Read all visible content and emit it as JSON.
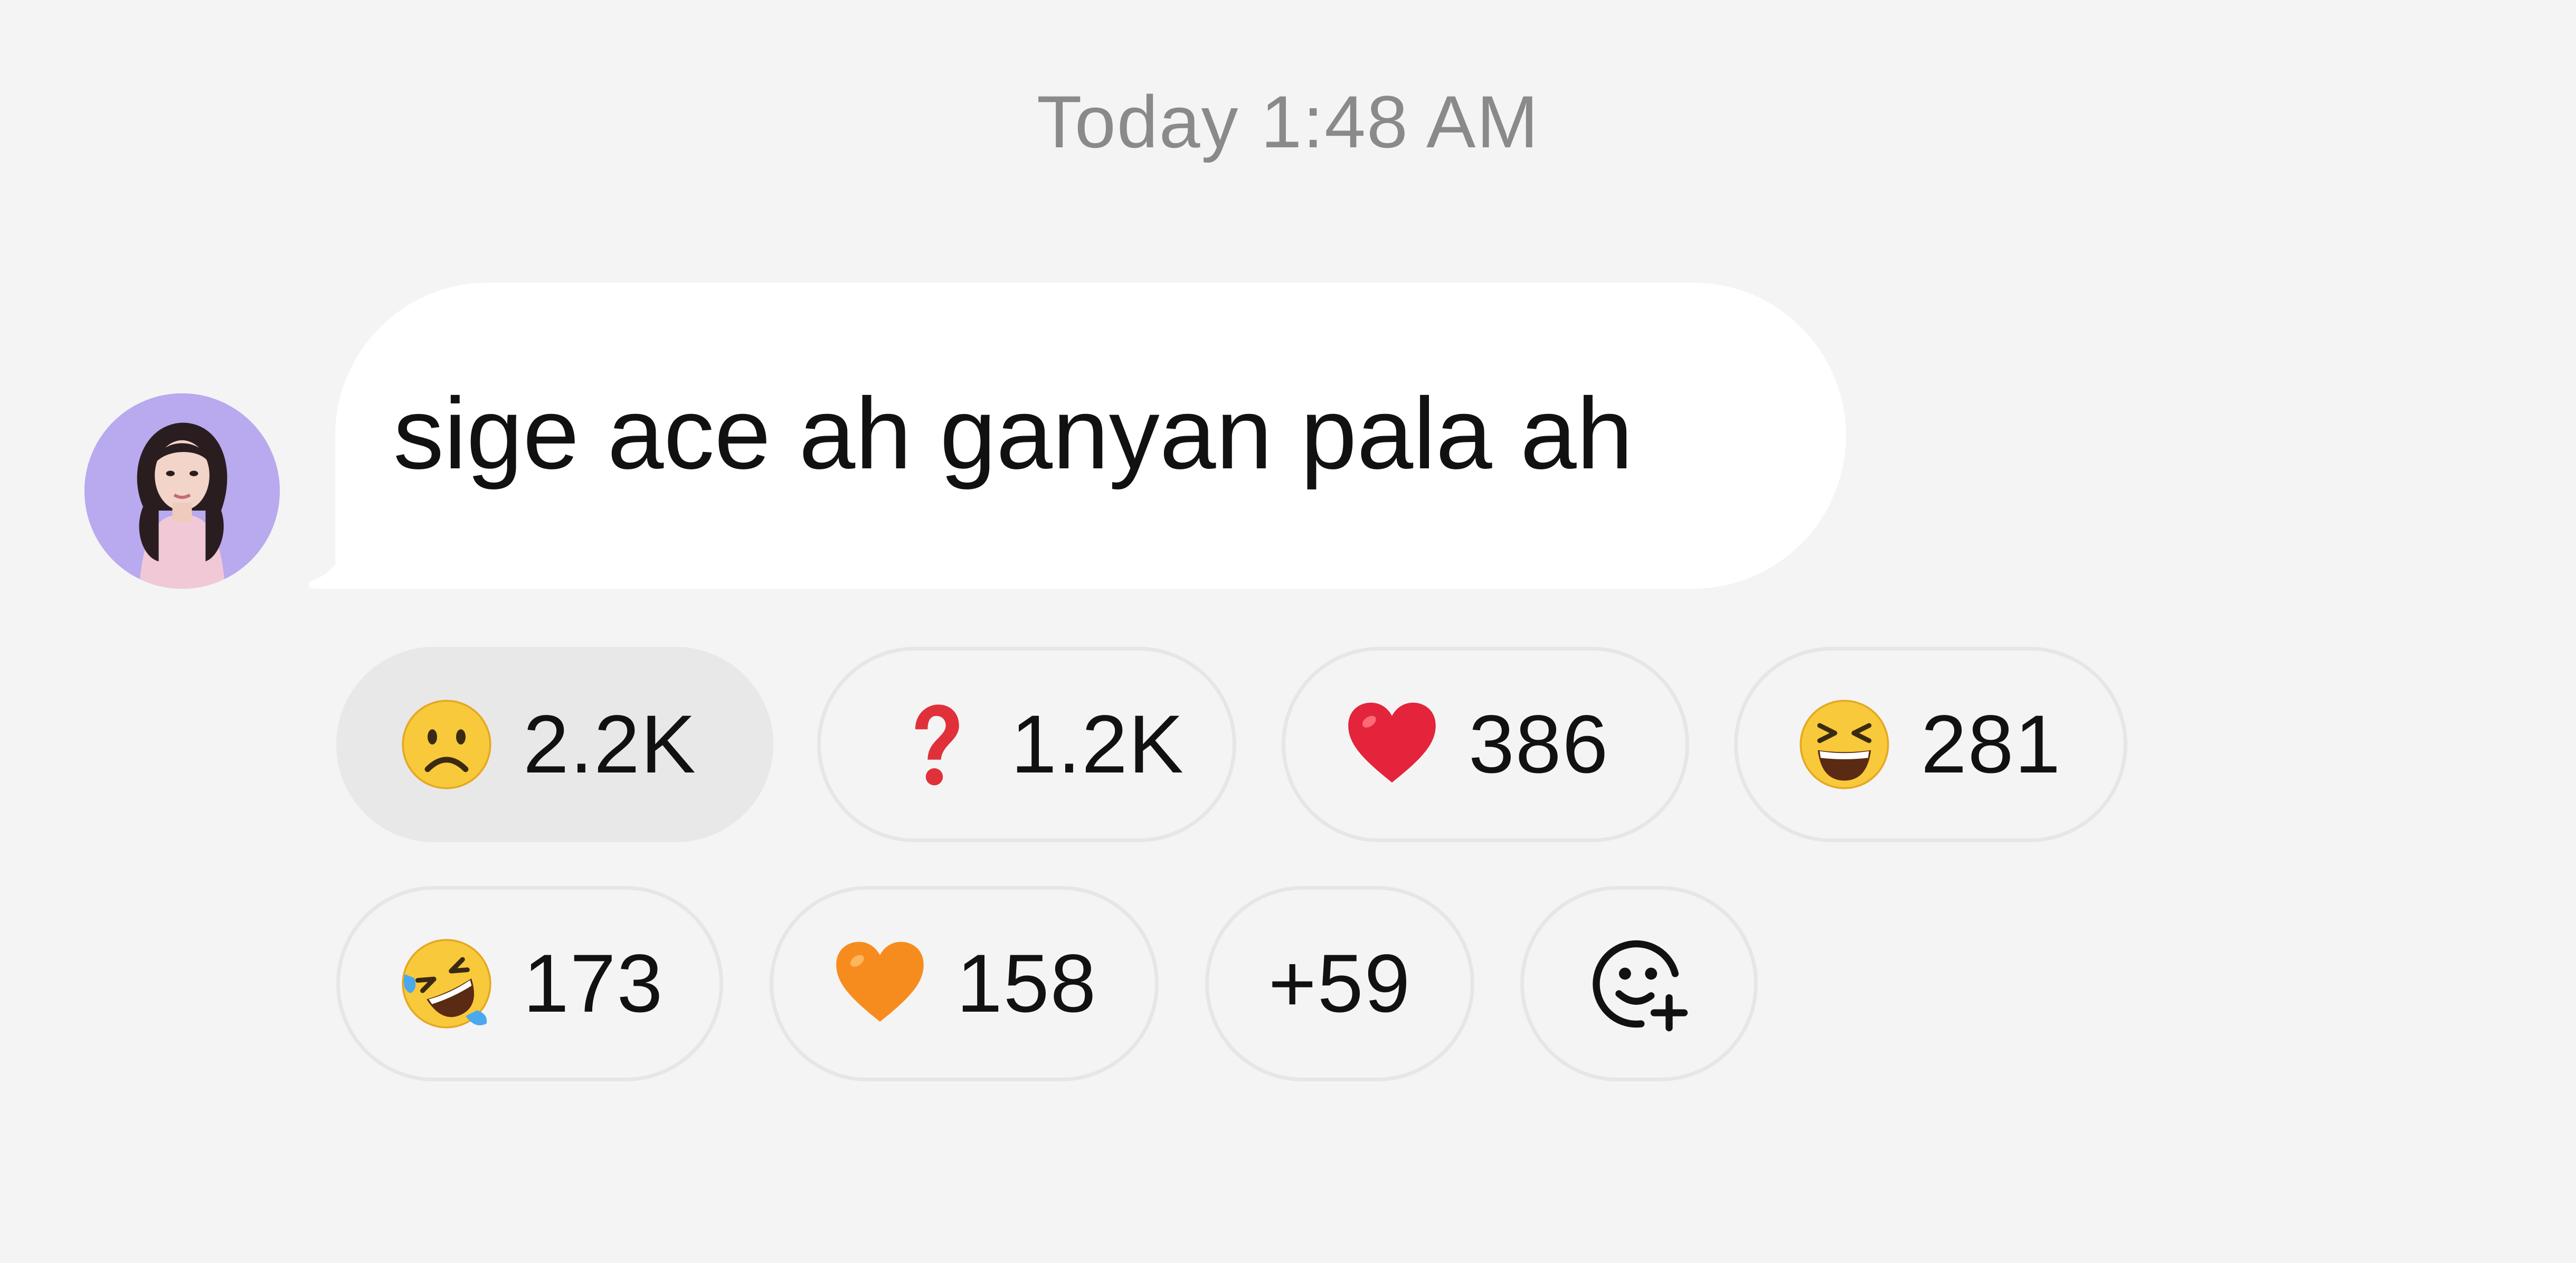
{
  "timestamp": "Today 1:48 AM",
  "message": {
    "text": "sige ace ah ganyan pala ah",
    "avatar_icon": "profile-photo"
  },
  "reactions": [
    {
      "emoji": "frowning-face-icon",
      "count": "2.2K",
      "selected": true
    },
    {
      "emoji": "question-mark-icon",
      "count": "1.2K",
      "selected": false
    },
    {
      "emoji": "red-heart-icon",
      "count": "386",
      "selected": false
    },
    {
      "emoji": "laughing-face-icon",
      "count": "281",
      "selected": false
    },
    {
      "emoji": "rofl-face-icon",
      "count": "173",
      "selected": false
    },
    {
      "emoji": "orange-heart-icon",
      "count": "158",
      "selected": false
    }
  ],
  "more_reactions": "+59",
  "add_reaction_icon": "add-reaction-icon",
  "colors": {
    "background": "#f4f4f4",
    "bubble": "#ffffff",
    "selected_reaction": "#e8e8e8",
    "pill_border": "#e6e6e6",
    "timestamp_text": "#8a8a8a"
  }
}
